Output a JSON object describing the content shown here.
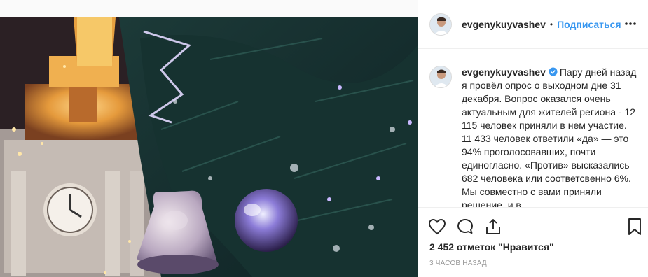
{
  "post": {
    "username": "evgenykuyvashev",
    "dot": "•",
    "follow_label": "Подписаться",
    "caption": "Пару дней назад я провёл опрос о выходном дне 31 декабря. Вопрос оказался очень актуальным для жителей региона - 12 115 человек приняли в нем участие. 11 433 человек ответили «да» — это 94% проголосовавших, почти единогласно. «Против» высказались 682 человека или соответсвенно 6%. Мы совместно с вами приняли решение, и в",
    "likes": "2 452 отметок \"Нравится\"",
    "time": "3 часов назад"
  },
  "icons": {
    "more": "more-horizontal-icon",
    "verified": "verified-badge-icon",
    "like": "heart-icon",
    "comment": "comment-icon",
    "share": "share-icon",
    "save": "bookmark-icon"
  },
  "colors": {
    "link": "#3897f0",
    "verified": "#3897f0",
    "text": "#262626",
    "muted": "#999999"
  }
}
